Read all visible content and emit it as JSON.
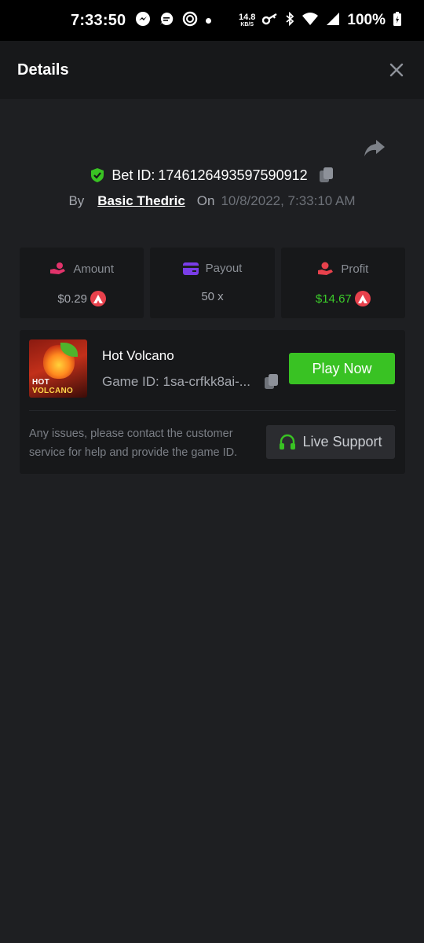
{
  "status_bar": {
    "time": "7:33:50",
    "net_speed": "14.8",
    "net_unit": "KB/S",
    "battery": "100%"
  },
  "header": {
    "title": "Details"
  },
  "bet": {
    "id_label": "Bet ID:",
    "id_value": "1746126493597590912",
    "by_label": "By",
    "user": "Basic Thedric",
    "on_label": "On",
    "date": "10/8/2022, 7:33:10 AM"
  },
  "stats": [
    {
      "label": "Amount",
      "value": "$0.29",
      "icon": "coins-hand-icon",
      "color": "#e2336b"
    },
    {
      "label": "Payout",
      "value": "50 x",
      "icon": "card-icon",
      "color": "#7a3de8"
    },
    {
      "label": "Profit",
      "value": "$14.67",
      "icon": "profit-hand-icon",
      "color": "#e8414c"
    }
  ],
  "game": {
    "name": "Hot Volcano",
    "id_label": "Game ID:",
    "id_value": "1sa-crfkk8ai-...",
    "thumb_line1": "HOT",
    "thumb_line2": "VOLCANO",
    "play_label": "Play Now",
    "issue_text": "Any issues, please contact the customer service for help and provide the game ID.",
    "support_label": "Live Support"
  },
  "colors": {
    "background": "#1e1f22",
    "card": "#17181a",
    "accent_green": "#39c223",
    "coin_red": "#e8414c"
  }
}
